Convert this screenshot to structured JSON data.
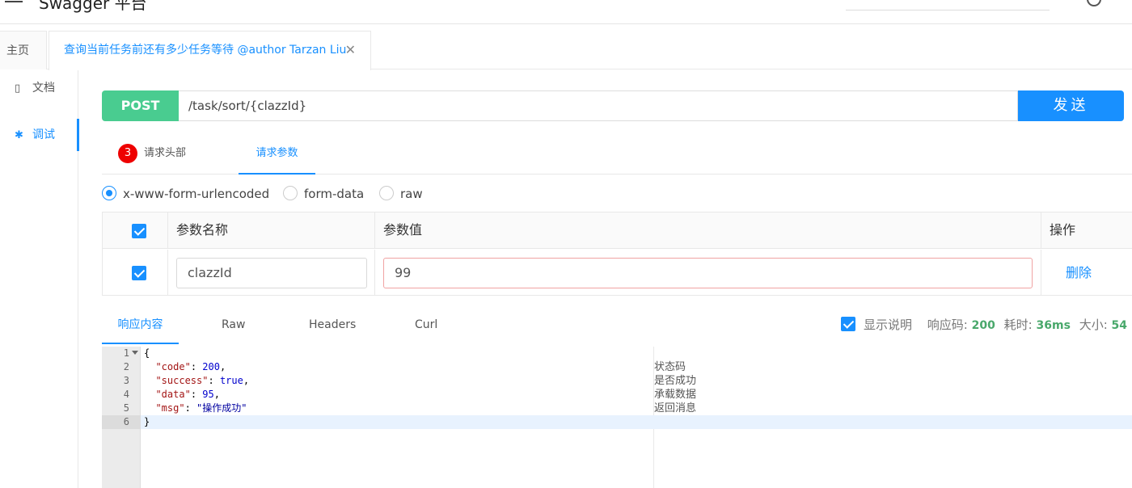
{
  "topbar": {
    "title": "Swagger 平台"
  },
  "tabs": {
    "home": "主页",
    "active": "查询当前任务前还有多少任务等待 @author Tarzan Liu",
    "close": "✕"
  },
  "sidebar": {
    "items": [
      {
        "label": "文档",
        "icon": "document-icon"
      },
      {
        "label": "调试",
        "icon": "bug-icon"
      }
    ]
  },
  "request": {
    "method": "POST",
    "url": "/task/sort/{clazzId}",
    "send_label": "发送"
  },
  "request_tabs": {
    "headers_badge": "3",
    "headers": "请求头部",
    "params": "请求参数"
  },
  "body_types": [
    "x-www-form-urlencoded",
    "form-data",
    "raw"
  ],
  "params_table": {
    "columns": [
      "参数名称",
      "参数值",
      "操作"
    ],
    "rows": [
      {
        "name": "clazzId",
        "value": "99",
        "action": "删除"
      }
    ]
  },
  "response_tabs": [
    "响应内容",
    "Raw",
    "Headers",
    "Curl"
  ],
  "response_meta": {
    "show_desc": "显示说明",
    "code_label": "响应码:",
    "code": "200",
    "time_label": "耗时:",
    "time": "36ms",
    "size_label": "大小:",
    "size": "54"
  },
  "editor": {
    "line_numbers": [
      "1",
      "2",
      "3",
      "4",
      "5",
      "6"
    ],
    "lines": [
      {
        "open": "{"
      },
      {
        "key": "\"code\"",
        "sep": ": ",
        "value": "200",
        "tail": ",",
        "note": "状态码"
      },
      {
        "key": "\"success\"",
        "sep": ": ",
        "value": "true",
        "tail": ",",
        "note": "是否成功"
      },
      {
        "key": "\"data\"",
        "sep": ": ",
        "value": "95",
        "tail": ",",
        "note": "承载数据"
      },
      {
        "key": "\"msg\"",
        "sep": ": ",
        "value": "\"操作成功\"",
        "tail": "",
        "note": "返回消息"
      },
      {
        "close": "}"
      }
    ]
  },
  "colors": {
    "accent": "#1890ff",
    "post_method": "#49cc90",
    "badge": "#e00000",
    "success_value": "#49a86b"
  }
}
